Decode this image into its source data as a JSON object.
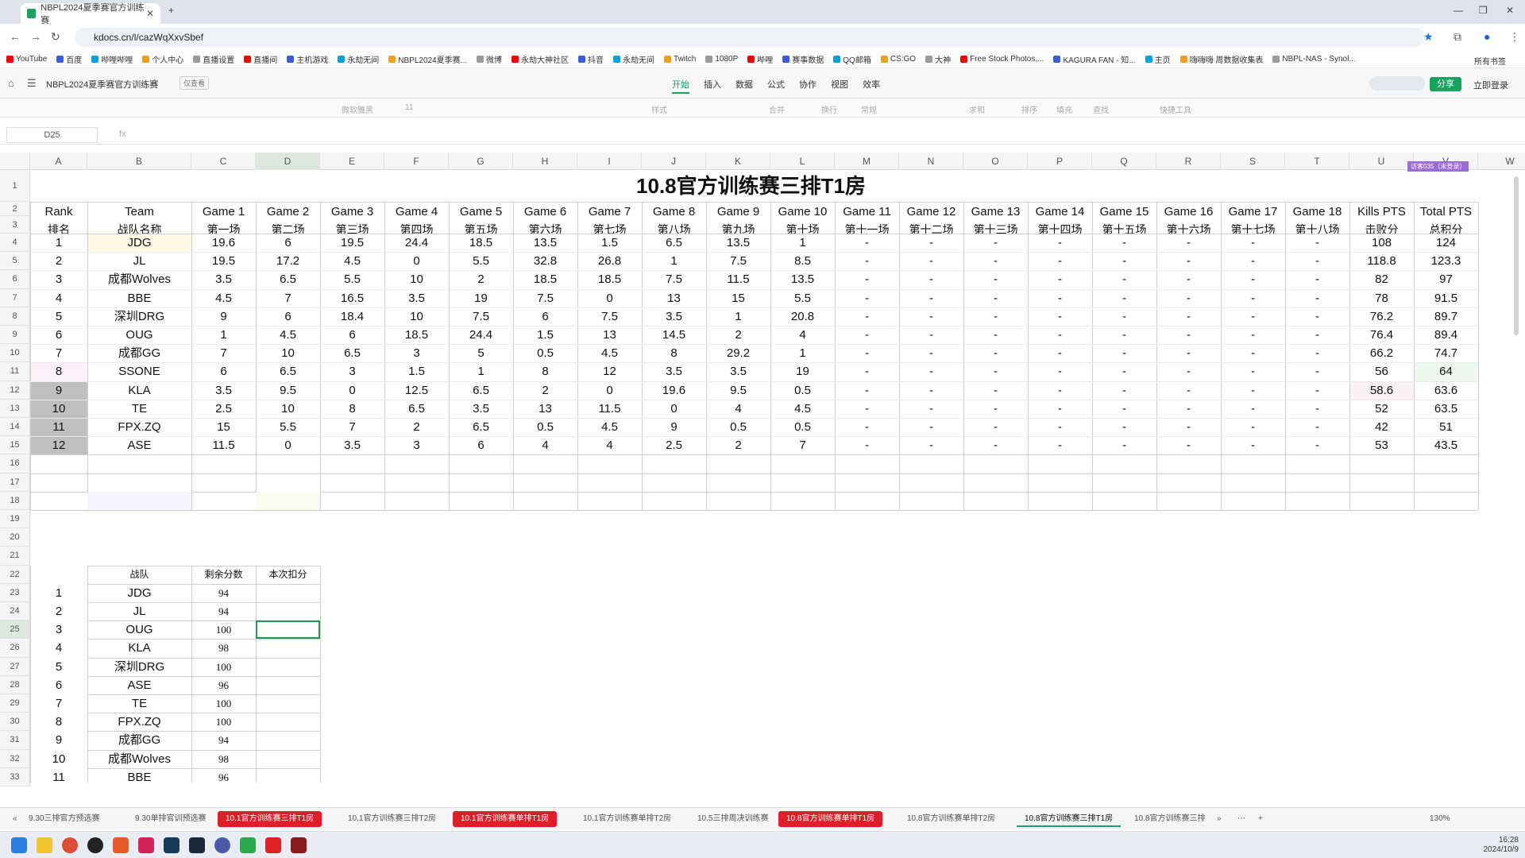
{
  "browser": {
    "tab_title": "NBPL2024夏季赛官方训练赛",
    "url": "kdocs.cn/l/cazWqXxvSbef",
    "bookmarks": [
      "YouTube",
      "百度",
      "哔哩哔哩",
      "个人中心",
      "直播设置",
      "直播间",
      "主机游戏",
      "永劫无间",
      "NBPL2024夏季赛...",
      "微博",
      "永劫大神社区",
      "抖音",
      "永劫无间",
      "Twitch",
      "1080P",
      "哔哩",
      "赛事数据",
      "QQ邮箱",
      "CS:GO",
      "大神",
      "Free Stock Photos,...",
      "KAGURA FAN - 知...",
      "主页",
      "嗨嗨嗨 周数据收集表",
      "NBPL-NAS - Synol..."
    ],
    "all_bookmarks": "所有书签"
  },
  "app": {
    "doc_title": "NBPL2024夏季赛官方训练赛",
    "readonly_badge": "仅查看",
    "menu": [
      "开始",
      "插入",
      "数据",
      "公式",
      "协作",
      "视图",
      "效率"
    ],
    "share": "分享",
    "login": "立即登录"
  },
  "toolbar": [
    "微软雅黑",
    "11",
    "样式",
    "合并",
    "换行",
    "常规",
    "求和",
    "排序",
    "填充",
    "查找",
    "快捷工具"
  ],
  "formula": {
    "cell_ref": "D25",
    "fx": "fx"
  },
  "columns": [
    "A",
    "B",
    "C",
    "D",
    "E",
    "F",
    "G",
    "H",
    "I",
    "J",
    "K",
    "L",
    "M",
    "N",
    "O",
    "P",
    "Q",
    "R",
    "S",
    "T",
    "U",
    "V",
    "W"
  ],
  "rows": [
    "1",
    "2",
    "3",
    "4",
    "5",
    "6",
    "7",
    "8",
    "9",
    "10",
    "11",
    "12",
    "13",
    "14",
    "15",
    "16",
    "17",
    "18",
    "19",
    "20",
    "21",
    "22",
    "23",
    "24",
    "25",
    "26",
    "27",
    "28",
    "29",
    "30",
    "31",
    "32",
    "33"
  ],
  "sheet": {
    "title": "10.8官方训练赛三排T1房",
    "headers": [
      [
        "Rank",
        "排名"
      ],
      [
        "Team",
        "战队名称"
      ],
      [
        "Game 1",
        "第一场"
      ],
      [
        "Game 2",
        "第二场"
      ],
      [
        "Game 3",
        "第三场"
      ],
      [
        "Game 4",
        "第四场"
      ],
      [
        "Game 5",
        "第五场"
      ],
      [
        "Game 6",
        "第六场"
      ],
      [
        "Game 7",
        "第七场"
      ],
      [
        "Game 8",
        "第八场"
      ],
      [
        "Game 9",
        "第九场"
      ],
      [
        "Game 10",
        "第十场"
      ],
      [
        "Game 11",
        "第十一场"
      ],
      [
        "Game 12",
        "第十二场"
      ],
      [
        "Game 13",
        "第十三场"
      ],
      [
        "Game 14",
        "第十四场"
      ],
      [
        "Game 15",
        "第十五场"
      ],
      [
        "Game 16",
        "第十六场"
      ],
      [
        "Game 17",
        "第十七场"
      ],
      [
        "Game 18",
        "第十八场"
      ],
      [
        "Kills PTS",
        "击败分"
      ],
      [
        "Total PTS",
        "总积分"
      ]
    ],
    "rows": [
      [
        "1",
        "JDG",
        "19.6",
        "6",
        "19.5",
        "24.4",
        "18.5",
        "13.5",
        "1.5",
        "6.5",
        "13.5",
        "1",
        "-",
        "-",
        "-",
        "-",
        "-",
        "-",
        "-",
        "-",
        "108",
        "124"
      ],
      [
        "2",
        "JL",
        "19.5",
        "17.2",
        "4.5",
        "0",
        "5.5",
        "32.8",
        "26.8",
        "1",
        "7.5",
        "8.5",
        "-",
        "-",
        "-",
        "-",
        "-",
        "-",
        "-",
        "-",
        "118.8",
        "123.3"
      ],
      [
        "3",
        "成都Wolves",
        "3.5",
        "6.5",
        "5.5",
        "10",
        "2",
        "18.5",
        "18.5",
        "7.5",
        "11.5",
        "13.5",
        "-",
        "-",
        "-",
        "-",
        "-",
        "-",
        "-",
        "-",
        "82",
        "97"
      ],
      [
        "4",
        "BBE",
        "4.5",
        "7",
        "16.5",
        "3.5",
        "19",
        "7.5",
        "0",
        "13",
        "15",
        "5.5",
        "-",
        "-",
        "-",
        "-",
        "-",
        "-",
        "-",
        "-",
        "78",
        "91.5"
      ],
      [
        "5",
        "深圳DRG",
        "9",
        "6",
        "18.4",
        "10",
        "7.5",
        "6",
        "7.5",
        "3.5",
        "1",
        "20.8",
        "-",
        "-",
        "-",
        "-",
        "-",
        "-",
        "-",
        "-",
        "76.2",
        "89.7"
      ],
      [
        "6",
        "OUG",
        "1",
        "4.5",
        "6",
        "18.5",
        "24.4",
        "1.5",
        "13",
        "14.5",
        "2",
        "4",
        "-",
        "-",
        "-",
        "-",
        "-",
        "-",
        "-",
        "-",
        "76.4",
        "89.4"
      ],
      [
        "7",
        "成都GG",
        "7",
        "10",
        "6.5",
        "3",
        "5",
        "0.5",
        "4.5",
        "8",
        "29.2",
        "1",
        "-",
        "-",
        "-",
        "-",
        "-",
        "-",
        "-",
        "-",
        "66.2",
        "74.7"
      ],
      [
        "8",
        "SSONE",
        "6",
        "6.5",
        "3",
        "1.5",
        "1",
        "8",
        "12",
        "3.5",
        "3.5",
        "19",
        "-",
        "-",
        "-",
        "-",
        "-",
        "-",
        "-",
        "-",
        "56",
        "64"
      ],
      [
        "9",
        "KLA",
        "3.5",
        "9.5",
        "0",
        "12.5",
        "6.5",
        "2",
        "0",
        "19.6",
        "9.5",
        "0.5",
        "-",
        "-",
        "-",
        "-",
        "-",
        "-",
        "-",
        "-",
        "58.6",
        "63.6"
      ],
      [
        "10",
        "TE",
        "2.5",
        "10",
        "8",
        "6.5",
        "3.5",
        "13",
        "11.5",
        "0",
        "4",
        "4.5",
        "-",
        "-",
        "-",
        "-",
        "-",
        "-",
        "-",
        "-",
        "52",
        "63.5"
      ],
      [
        "11",
        "FPX.ZQ",
        "15",
        "5.5",
        "7",
        "2",
        "6.5",
        "0.5",
        "4.5",
        "9",
        "0.5",
        "0.5",
        "-",
        "-",
        "-",
        "-",
        "-",
        "-",
        "-",
        "-",
        "42",
        "51"
      ],
      [
        "12",
        "ASE",
        "11.5",
        "0",
        "3.5",
        "3",
        "6",
        "4",
        "4",
        "2.5",
        "2",
        "7",
        "-",
        "-",
        "-",
        "-",
        "-",
        "-",
        "-",
        "-",
        "53",
        "43.5"
      ]
    ],
    "sub_headers": [
      "战队",
      "剩余分数",
      "本次扣分"
    ],
    "sub_rows": [
      [
        "1",
        "JDG",
        "94",
        ""
      ],
      [
        "2",
        "JL",
        "94",
        ""
      ],
      [
        "3",
        "OUG",
        "100",
        ""
      ],
      [
        "4",
        "KLA",
        "98",
        ""
      ],
      [
        "5",
        "深圳DRG",
        "100",
        ""
      ],
      [
        "6",
        "ASE",
        "96",
        ""
      ],
      [
        "7",
        "TE",
        "100",
        ""
      ],
      [
        "8",
        "FPX.ZQ",
        "100",
        ""
      ],
      [
        "9",
        "成都GG",
        "94",
        ""
      ],
      [
        "10",
        "成都Wolves",
        "98",
        ""
      ],
      [
        "11",
        "BBE",
        "96",
        ""
      ]
    ],
    "v_col_tag": "访客035（未登录）"
  },
  "sheet_tabs": [
    {
      "label": "9.30三排官方预选赛",
      "style": "normal"
    },
    {
      "label": "9.30单排官训预选赛",
      "style": "normal"
    },
    {
      "label": "10.1官方训练赛三排T1房",
      "style": "red"
    },
    {
      "label": "10.1官方训练赛三排T2房",
      "style": "normal"
    },
    {
      "label": "10.1官方训练赛单排T1房",
      "style": "red"
    },
    {
      "label": "10.1官方训练赛单排T2房",
      "style": "normal"
    },
    {
      "label": "10.5三排周决训练赛",
      "style": "normal"
    },
    {
      "label": "10.8官方训练赛单排T1房",
      "style": "red"
    },
    {
      "label": "10.8官方训练赛单排T2房",
      "style": "normal"
    },
    {
      "label": "10.8官方训练赛三排T1房",
      "style": "active"
    },
    {
      "label": "10.8官方训练赛三排",
      "style": "normal"
    }
  ],
  "zoom": "130%",
  "clock": {
    "time": "16:28",
    "date": "2024/10/9"
  }
}
